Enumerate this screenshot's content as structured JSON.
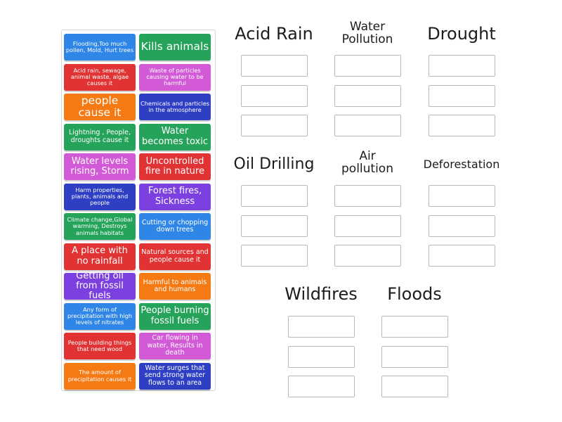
{
  "colors": {
    "blue": "#2f86e6",
    "green": "#26a35a",
    "red": "#e13333",
    "pink": "#d35ad6",
    "orange": "#f57a14",
    "navy": "#2e3fc4",
    "purple": "#7c3fe0"
  },
  "cards": [
    "Flooding,Too much pollen, Mold, Hurt trees",
    "Kills animals",
    "Acid rain, sewage, animal waste, algae causes it",
    "Waste of particles causing water to be harmful",
    "people cause it",
    "Chemicals and particles in the atmosphere",
    "Lightning , People, droughts cause it",
    "Water becomes toxic",
    "Water levels rising, Storm",
    "Uncontrolled fire in nature",
    "Harm properties, plants, animals and people",
    "Forest fires, Sickness",
    "Climate change,Global warming, Destroys animals habitats",
    "Cutting or chopping down trees",
    "A place with no rainfall",
    "Natural sources and people cause it",
    "Getting oil from fossil fuels",
    "Harmful to animals and humans",
    "Any form of precipitation with high levels of nitrates",
    "People burning fossil fuels",
    "People building things that need wood",
    "Car flowing in water, Results in death",
    "The amount of precipitation causes it",
    "Water surges that send strong water flows to an area"
  ],
  "categories": [
    "Acid Rain",
    "Water Pollution",
    "Drought",
    "Oil Drilling",
    "Air pollution",
    "Deforestation",
    "Wildfires",
    "Floods"
  ]
}
